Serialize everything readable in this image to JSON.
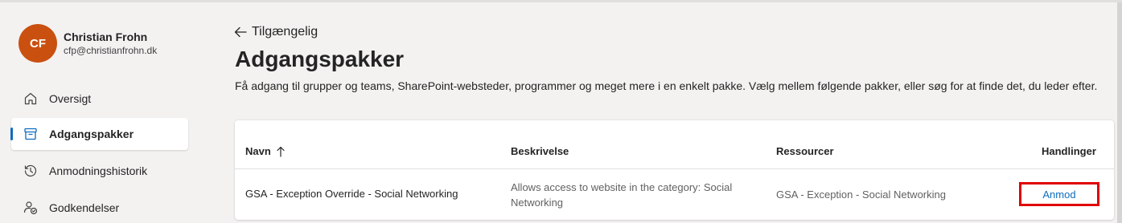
{
  "colors": {
    "accent": "#0f6cbd",
    "avatar_bg": "#ca5010",
    "highlight_border": "#e00000"
  },
  "user": {
    "initials": "CF",
    "name": "Christian Frohn",
    "email": "cfp@christianfrohn.dk"
  },
  "sidebar": {
    "items": [
      {
        "label": "Oversigt",
        "icon": "home-icon",
        "active": false
      },
      {
        "label": "Adgangspakker",
        "icon": "archive-icon",
        "active": true
      },
      {
        "label": "Anmodningshistorik",
        "icon": "history-icon",
        "active": false
      },
      {
        "label": "Godkendelser",
        "icon": "person-check-icon",
        "active": false
      }
    ]
  },
  "header": {
    "back_label": "Tilgængelig",
    "title": "Adgangspakker",
    "description": "Få adgang til grupper og teams, SharePoint-websteder, programmer og meget mere i en enkelt pakke. Vælg mellem følgende pakker, eller søg for at finde det, du leder efter."
  },
  "table": {
    "columns": [
      "Navn",
      "Beskrivelse",
      "Ressourcer",
      "Handlinger"
    ],
    "sort_icon": "arrow-up-icon",
    "rows": [
      {
        "name": "GSA - Exception Override - Social Networking",
        "description_line1": "Allows access to website in the category: Social",
        "description_line2": "Networking",
        "resources": "GSA - Exception - Social Networking",
        "action": "Anmod"
      }
    ]
  }
}
